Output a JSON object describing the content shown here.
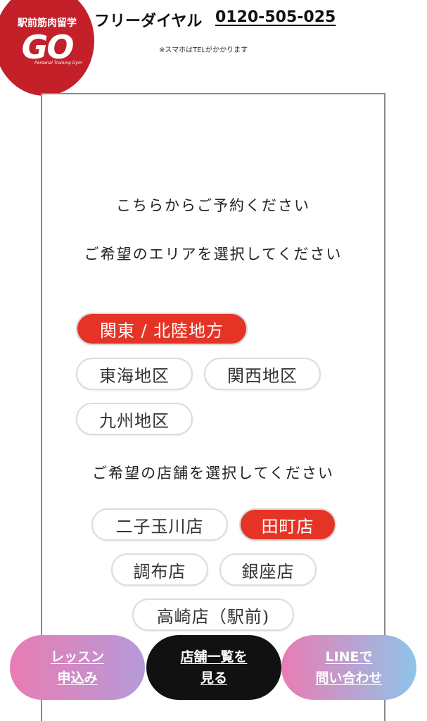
{
  "header": {
    "logo_top": "駅前筋肉留学",
    "logo_main": "GO",
    "logo_sub": "Personal Training Gym",
    "phone_label": "フリーダイヤル",
    "phone_number": "0120-505-025",
    "phone_note": "※スマホはTELがかかります"
  },
  "reservation": {
    "heading": "こちらからご予約ください",
    "area_heading": "ご希望のエリアを選択してください",
    "areas": [
      {
        "label": "関東 / 北陸地方",
        "selected": true
      },
      {
        "label": "東海地区",
        "selected": false
      },
      {
        "label": "関西地区",
        "selected": false
      },
      {
        "label": "九州地区",
        "selected": false
      }
    ],
    "store_heading": "ご希望の店舗を選択してください",
    "stores": [
      {
        "label": "二子玉川店",
        "selected": false
      },
      {
        "label": "田町店",
        "selected": true
      },
      {
        "label": "調布店",
        "selected": false
      },
      {
        "label": "銀座店",
        "selected": false
      },
      {
        "label": "高崎店（駅前)",
        "selected": false
      }
    ]
  },
  "bottom_bar": {
    "lesson_line1": "レッスン",
    "lesson_line2": "申込み",
    "stores_line1": "店舗一覧を",
    "stores_line2": "見る",
    "line_line1": "LINEで",
    "line_line2": "問い合わせ"
  },
  "colors": {
    "brand_red": "#c4202a",
    "selected_red": "#e53425",
    "pill_border": "#dcdcdc"
  }
}
